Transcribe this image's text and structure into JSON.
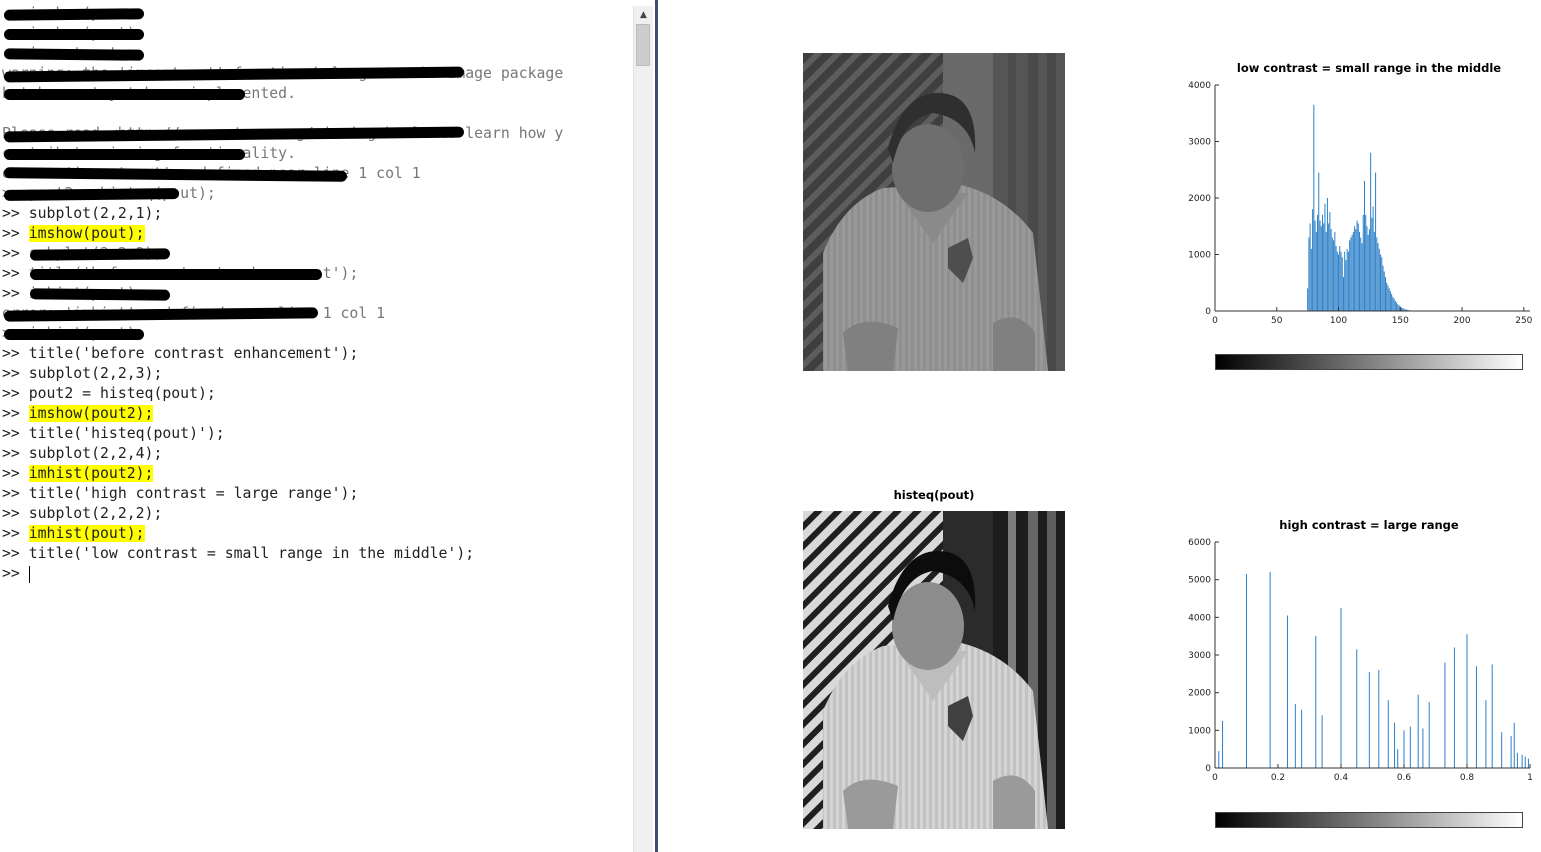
{
  "terminal": {
    "lines": [
      {
        "prefix": "",
        "text": "   imshow(p",
        "redacted": true
      },
      {
        "prefix": "",
        "text": "   imshow(pout);",
        "redacted": true
      },
      {
        "prefix": "",
        "text": "   imcontr  t",
        "redacted": true
      },
      {
        "prefix": "",
        "text": "warning: the 'imcontrast' function belongs to the image package",
        "redacted": true
      },
      {
        "prefix": "",
        "text": "but has not yet been implemented.",
        "redacted": true
      },
      {
        "prefix": "",
        "text": "",
        "redacted": false
      },
      {
        "prefix": "",
        "text": "Please read <http://www.octave.org/missing.html> to learn how y",
        "redacted": true
      },
      {
        "prefix": "",
        "text": "contribute missing functionality.",
        "redacted": true
      },
      {
        "prefix": "",
        "text": "error: 'imcontrast' undefined near line 1 col 1",
        "redacted": true
      },
      {
        "prefix": "",
        "text": ">> pout2 = histeq(pout);",
        "redacted": true
      },
      {
        "prefix": ">> ",
        "text": "subplot(2,2,1);",
        "redacted": false
      },
      {
        "prefix": ">> ",
        "text": "imshow(pout);",
        "highlight": true,
        "redacted": false
      },
      {
        "prefix": ">> ",
        "text": "subplot(2,2,2);",
        "redacted": true
      },
      {
        "prefix": ">> ",
        "text": "title('before contrast enhancement');",
        "redacted": true
      },
      {
        "prefix": ">> ",
        "text": "imhist(pout);",
        "redacted": true
      },
      {
        "prefix": "",
        "text": "error: 'imhist' undefined near line 1 col 1",
        "redacted": true
      },
      {
        "prefix": "",
        "text": ">> imhist(pout);",
        "redacted": true
      },
      {
        "prefix": ">> ",
        "text": "title('before contrast enhancement');",
        "redacted": false
      },
      {
        "prefix": ">> ",
        "text": "subplot(2,2,3);",
        "redacted": false
      },
      {
        "prefix": ">> ",
        "text": "pout2 = histeq(pout);",
        "redacted": false
      },
      {
        "prefix": ">> ",
        "text": "imshow(pout2);",
        "highlight": true,
        "redacted": false
      },
      {
        "prefix": ">> ",
        "text": "title('histeq(pout)');",
        "redacted": false
      },
      {
        "prefix": ">> ",
        "text": "subplot(2,2,4);",
        "redacted": false
      },
      {
        "prefix": ">> ",
        "text": "imhist(pout2);",
        "highlight": true,
        "redacted": false
      },
      {
        "prefix": ">> ",
        "text": "title('high contrast = large range');",
        "redacted": false
      },
      {
        "prefix": ">> ",
        "text": "subplot(2,2,2);",
        "redacted": false
      },
      {
        "prefix": ">> ",
        "text": "imhist(pout);",
        "highlight": true,
        "redacted": false
      },
      {
        "prefix": ">> ",
        "text": "title('low contrast = small range in the middle');",
        "redacted": false
      },
      {
        "prefix": ">> ",
        "text": "",
        "cursor": true,
        "redacted": false
      }
    ]
  },
  "figure": {
    "image_top": {
      "title": "",
      "description": "low-contrast grayscale photo (pout)"
    },
    "image_bottom": {
      "title": "histeq(pout)",
      "description": "histogram-equalized grayscale photo (pout2)"
    }
  },
  "chart_data": [
    {
      "type": "bar",
      "title": "low contrast = small range in the middle",
      "xlim": [
        0,
        255
      ],
      "ylim": [
        0,
        4000
      ],
      "xticks": [
        "0",
        "50",
        "100",
        "150",
        "200",
        "250"
      ],
      "yticks": [
        "0",
        "1000",
        "2000",
        "3000",
        "4000"
      ],
      "color": "#2a7fc8",
      "x": [
        75,
        76,
        77,
        78,
        79,
        80,
        81,
        82,
        83,
        84,
        85,
        86,
        87,
        88,
        89,
        90,
        91,
        92,
        93,
        94,
        95,
        96,
        97,
        98,
        99,
        100,
        101,
        102,
        103,
        104,
        105,
        106,
        107,
        108,
        109,
        110,
        111,
        112,
        113,
        114,
        115,
        116,
        117,
        118,
        119,
        120,
        121,
        122,
        123,
        124,
        125,
        126,
        127,
        128,
        129,
        130,
        131,
        132,
        133,
        134,
        135,
        136,
        137,
        138,
        139,
        140,
        141,
        142,
        143,
        144,
        145,
        146,
        147,
        148,
        149,
        150,
        151,
        152,
        153,
        154,
        155,
        156,
        157,
        158,
        159,
        160
      ],
      "values": [
        400,
        1300,
        1550,
        1100,
        1800,
        3650,
        1600,
        1400,
        1700,
        2450,
        1600,
        1500,
        1700,
        1550,
        1900,
        1400,
        2000,
        1550,
        1750,
        1450,
        1300,
        1250,
        1400,
        1150,
        1050,
        1000,
        1150,
        1050,
        950,
        600,
        1050,
        900,
        1100,
        1050,
        1250,
        1300,
        1350,
        1400,
        1500,
        1450,
        1600,
        1550,
        1400,
        1300,
        1200,
        1700,
        2300,
        1700,
        1500,
        1350,
        1450,
        2800,
        1650,
        1850,
        1400,
        2450,
        1300,
        1200,
        1100,
        1000,
        950,
        800,
        700,
        600,
        500,
        450,
        400,
        350,
        300,
        250,
        220,
        180,
        150,
        120,
        100,
        80,
        60,
        50,
        40,
        30,
        25,
        20,
        15,
        10,
        8,
        5
      ]
    },
    {
      "type": "bar",
      "title": "high contrast = large range",
      "xlim": [
        0,
        1
      ],
      "ylim": [
        0,
        6000
      ],
      "xticks": [
        "0",
        "0.2",
        "0.4",
        "0.6",
        "0.8",
        "1"
      ],
      "yticks": [
        "0",
        "1000",
        "2000",
        "3000",
        "4000",
        "5000",
        "6000"
      ],
      "color": "#2a7fc8",
      "x": [
        0.012,
        0.024,
        0.1,
        0.175,
        0.23,
        0.255,
        0.275,
        0.32,
        0.34,
        0.4,
        0.45,
        0.49,
        0.52,
        0.55,
        0.57,
        0.58,
        0.6,
        0.62,
        0.645,
        0.66,
        0.68,
        0.73,
        0.76,
        0.8,
        0.83,
        0.86,
        0.88,
        0.91,
        0.94,
        0.95,
        0.96,
        0.975,
        0.985,
        0.995
      ],
      "values": [
        450,
        1250,
        5150,
        5200,
        4050,
        1700,
        1550,
        3500,
        1400,
        4250,
        3150,
        2550,
        2600,
        1800,
        1200,
        500,
        1000,
        1100,
        1950,
        1050,
        1750,
        2800,
        3200,
        3550,
        2700,
        1800,
        2750,
        950,
        850,
        1200,
        400,
        350,
        300,
        250
      ]
    }
  ]
}
